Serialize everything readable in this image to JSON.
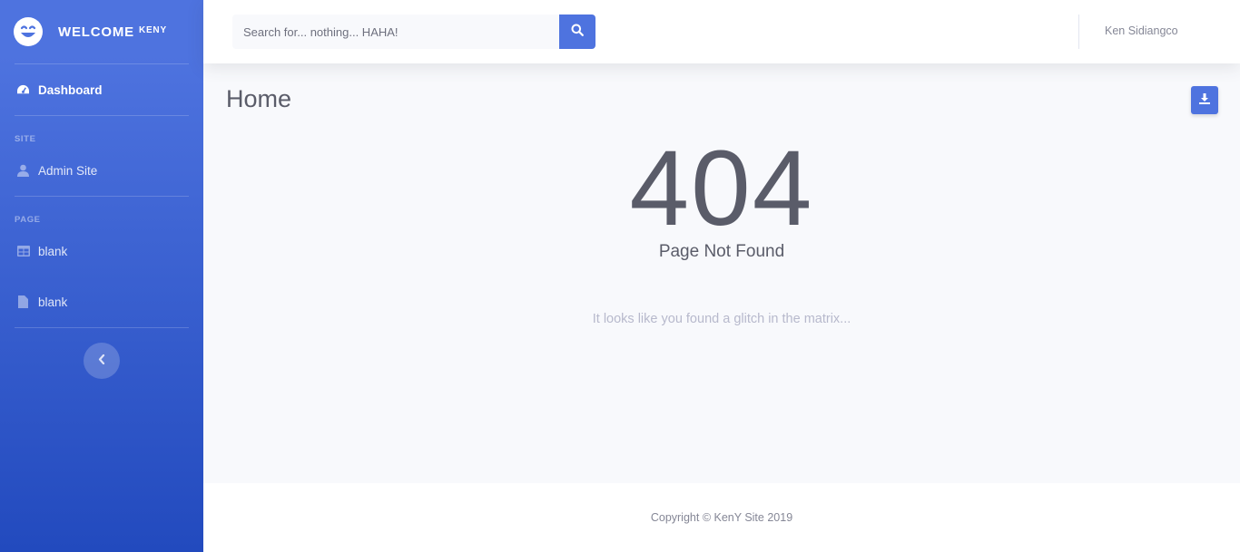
{
  "brand": {
    "title": "WELCOME",
    "superscript": "KENY",
    "logo_icon": "laugh-wink-icon"
  },
  "sidebar": {
    "dashboard": {
      "label": "Dashboard",
      "icon": "tachometer-icon"
    },
    "sections": [
      {
        "heading": "SITE",
        "items": [
          {
            "label": "Admin Site",
            "icon": "user-icon"
          }
        ]
      },
      {
        "heading": "PAGE",
        "items": [
          {
            "label": "blank",
            "icon": "table-icon"
          },
          {
            "label": "blank",
            "icon": "file-icon"
          }
        ]
      }
    ],
    "toggle_icon": "chevron-left-icon"
  },
  "topbar": {
    "search_placeholder": "Search for... nothing... HAHA!",
    "search_icon": "search-icon",
    "user_name": "Ken Sidiangco"
  },
  "main": {
    "title": "Home",
    "report_icon": "download-icon",
    "error_code": "404",
    "error_title": "Page Not Found",
    "error_message": "It looks like you found a glitch in the matrix..."
  },
  "footer": {
    "copyright": "Copyright © KenY Site 2019"
  },
  "colors": {
    "primary": "#4e73df",
    "primary_dark": "#224abe",
    "text_dark": "#5a5c69",
    "text_muted": "#858796",
    "background": "#f8f9fc"
  }
}
